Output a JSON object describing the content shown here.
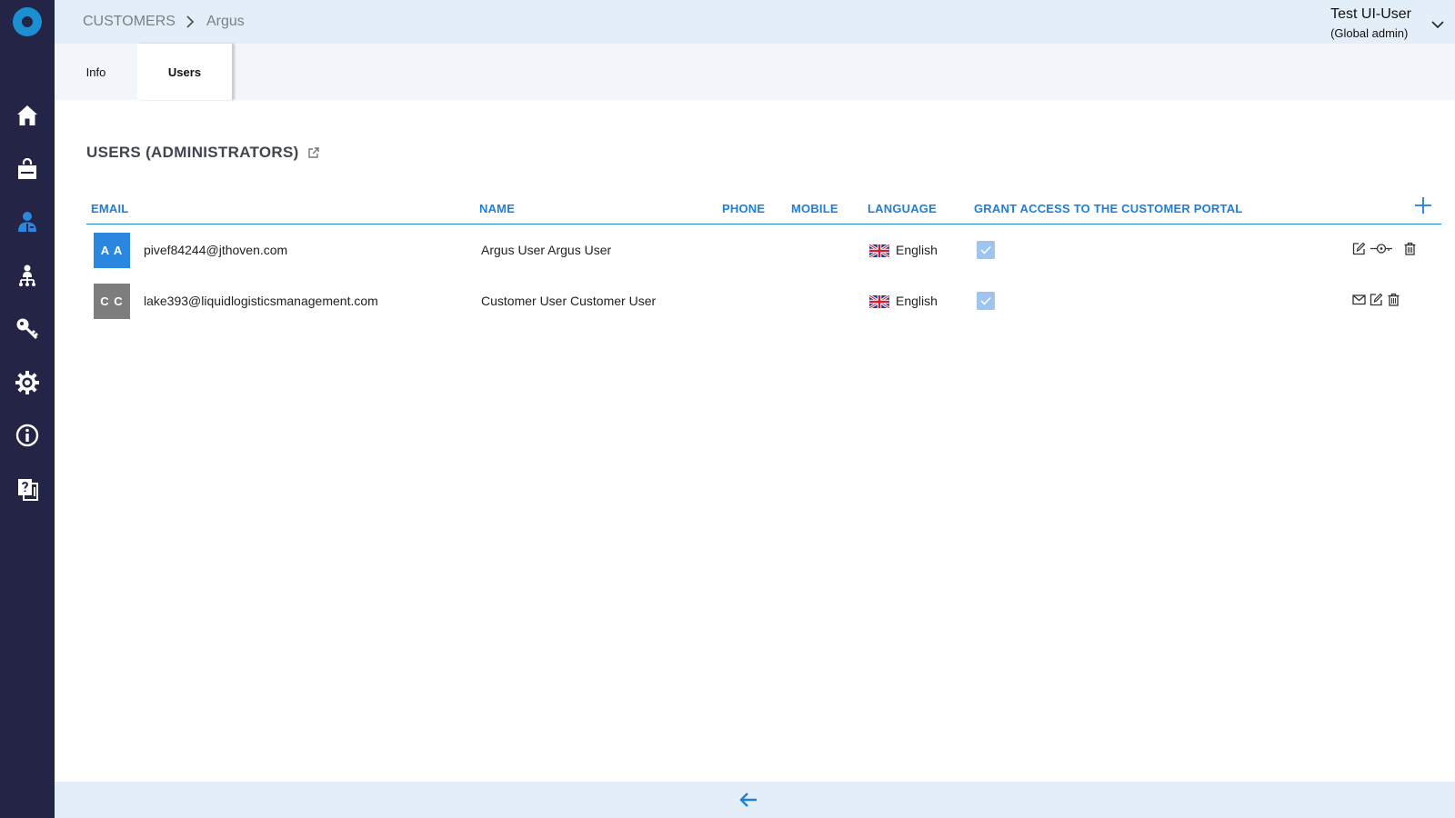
{
  "breadcrumb": {
    "root": "CUSTOMERS",
    "current": "Argus"
  },
  "user": {
    "name": "Test UI-User",
    "role": "(Global admin)"
  },
  "tabs": [
    {
      "label": "Info",
      "active": false
    },
    {
      "label": "Users",
      "active": true
    }
  ],
  "section": {
    "title": "USERS (ADMINISTRATORS)"
  },
  "table": {
    "headers": [
      "EMAIL",
      "NAME",
      "PHONE",
      "MOBILE",
      "LANGUAGE",
      "GRANT ACCESS TO THE CUSTOMER PORTAL"
    ],
    "rows": [
      {
        "initials": "A A",
        "avatar_color": "#2b86e0",
        "email": "pivef84244@jthoven.com",
        "name": "Argus User Argus User",
        "phone": "",
        "mobile": "",
        "language": "English",
        "portal_access": true,
        "actions": [
          "edit-icon",
          "key-icon",
          "trash-icon"
        ]
      },
      {
        "initials": "C C",
        "avatar_color": "#7d7d7d",
        "email": "lake393@liquidlogisticsmanagement.com",
        "name": "Customer User Customer User",
        "phone": "",
        "mobile": "",
        "language": "English",
        "portal_access": true,
        "actions": [
          "mail-icon",
          "edit-icon",
          "trash-icon"
        ]
      }
    ]
  },
  "colors": {
    "sidebar": "#242447",
    "accent": "#1e7fd6",
    "header_bg": "#e4eef8",
    "checkbox": "#9fc4ee"
  },
  "sidebar_icons": [
    "home-icon",
    "shopping-bag-icon",
    "customers-icon",
    "hierarchy-icon",
    "key-icon",
    "settings-icon",
    "info-icon",
    "documents-icon"
  ]
}
